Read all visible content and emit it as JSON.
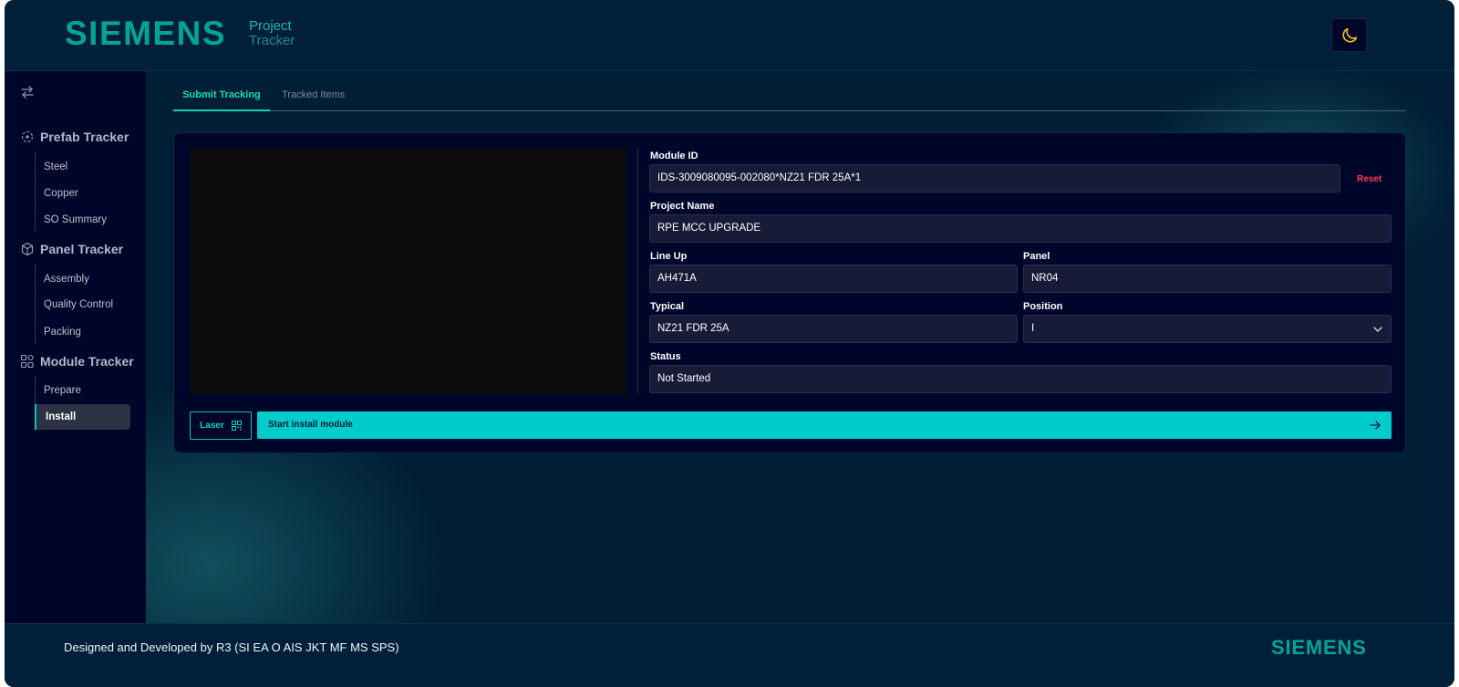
{
  "header": {
    "brand": "SIEMENS",
    "app_line1": "Project",
    "app_line2": "Tracker",
    "theme_icon": "moon-icon"
  },
  "sidebar": {
    "toggle_icon": "swap-arrows-icon",
    "sections": [
      {
        "label": "Prefab Tracker",
        "icon": "target-icon",
        "items": [
          "Steel",
          "Copper",
          "SO Summary"
        ]
      },
      {
        "label": "Panel Tracker",
        "icon": "cube-icon",
        "items": [
          "Assembly",
          "Quality Control",
          "Packing"
        ]
      },
      {
        "label": "Module Tracker",
        "icon": "modules-icon",
        "items": [
          "Prepare",
          "Install"
        ]
      }
    ],
    "active_item": "Install"
  },
  "tabs": [
    {
      "label": "Submit Tracking",
      "active": true
    },
    {
      "label": "Tracked Items",
      "active": false
    }
  ],
  "form": {
    "module_id": {
      "label": "Module ID",
      "value": "IDS-3009080095-002080*NZ21 FDR 25A*1"
    },
    "reset_label": "Reset",
    "project_name": {
      "label": "Project Name",
      "value": "RPE MCC UPGRADE"
    },
    "line_up": {
      "label": "Line Up",
      "value": "AH471A"
    },
    "panel": {
      "label": "Panel",
      "value": "NR04"
    },
    "typical": {
      "label": "Typical",
      "value": "NZ21 FDR 25A"
    },
    "position": {
      "label": "Position",
      "value": "I"
    },
    "status": {
      "label": "Status",
      "value": "Not Started"
    }
  },
  "actions": {
    "laser_label": "Laser",
    "start_label": "Start install module"
  },
  "footer": {
    "credit": "Designed and Developed by R3 (SI EA O AIS JKT MF MS SPS)",
    "brand": "SIEMENS"
  },
  "colors": {
    "accent": "#00cccc",
    "brand": "#00a39a",
    "active_tab": "#11e0a8",
    "reset": "#ff3b58"
  }
}
